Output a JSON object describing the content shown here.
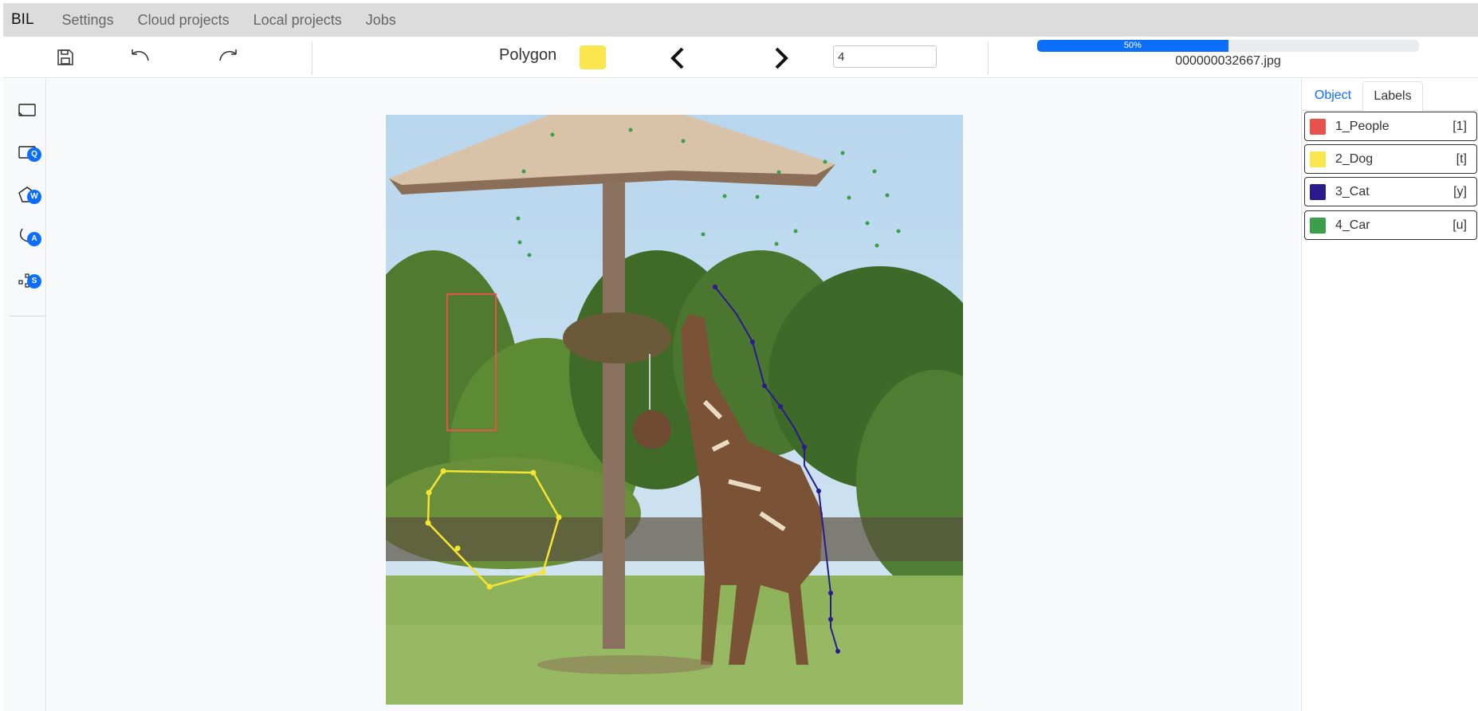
{
  "app": {
    "brand": "BIL"
  },
  "nav": {
    "items": [
      "Settings",
      "Cloud projects",
      "Local projects",
      "Jobs"
    ]
  },
  "toolbar": {
    "save_icon": "save-icon",
    "undo_icon": "undo-icon",
    "redo_icon": "redo-icon",
    "tool_name": "Polygon",
    "tool_color": "#fae64f",
    "prev_icon": "chevron-left-icon",
    "next_icon": "chevron-right-icon",
    "page_value": "4",
    "progress_label": "50%",
    "progress_value": 0.5,
    "filename": "000000032667.jpg"
  },
  "palette": {
    "tools": [
      {
        "icon": "crop-icon",
        "badge": ""
      },
      {
        "icon": "rectangle-icon",
        "badge": "Q"
      },
      {
        "icon": "polygon-icon",
        "badge": "W"
      },
      {
        "icon": "polyline-icon",
        "badge": "A"
      },
      {
        "icon": "points-icon",
        "badge": "S"
      }
    ]
  },
  "panel": {
    "tabs": [
      "Object",
      "Labels"
    ],
    "active_tab": "Labels",
    "labels": [
      {
        "name": "1_People",
        "key": "[1]",
        "color": "#e8524a"
      },
      {
        "name": "2_Dog",
        "key": "[t]",
        "color": "#fae64f"
      },
      {
        "name": "3_Cat",
        "key": "[y]",
        "color": "#2a1a8e"
      },
      {
        "name": "4_Car",
        "key": "[u]",
        "color": "#3aa04a"
      }
    ]
  },
  "colors": {
    "accent": "#0d6efd",
    "navbar": "#dcdcdc",
    "people": "#e8524a",
    "dog": "#fae64f",
    "cat": "#2a1a8e",
    "car": "#3aa04a"
  }
}
